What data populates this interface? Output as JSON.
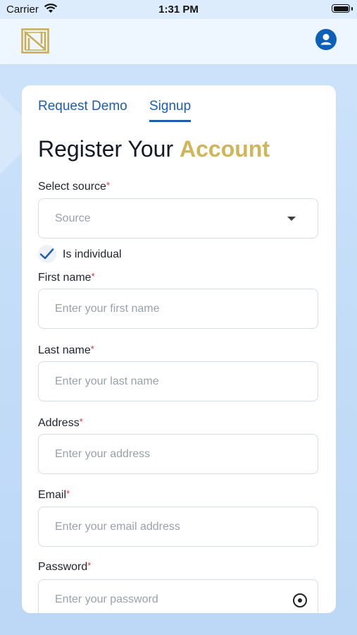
{
  "status_bar": {
    "carrier": "Carrier",
    "time": "1:31 PM"
  },
  "tabs": {
    "request_demo": "Request Demo",
    "signup": "Signup"
  },
  "heading": {
    "prefix": "Register Your ",
    "accent": "Account"
  },
  "colors": {
    "accent_gold": "#d0b658",
    "primary_blue": "#1e5db4",
    "required_red": "#d6373b"
  },
  "form": {
    "source": {
      "label": "Select source",
      "required_mark": "*",
      "placeholder": "Source"
    },
    "individual": {
      "label": "Is individual",
      "checked": true
    },
    "first_name": {
      "label": "First name",
      "required_mark": "*",
      "placeholder": "Enter your first name"
    },
    "last_name": {
      "label": "Last name",
      "required_mark": "*",
      "placeholder": "Enter your last name"
    },
    "address": {
      "label": "Address",
      "required_mark": "*",
      "placeholder": "Enter your address"
    },
    "email": {
      "label": "Email",
      "required_mark": "*",
      "placeholder": "Enter your email address"
    },
    "password": {
      "label": "Password",
      "required_mark": "*",
      "placeholder": "Enter your password"
    }
  },
  "icons": {
    "logo": "brand-logo",
    "profile": "user-profile-icon",
    "wifi": "wifi-icon",
    "battery": "battery-icon",
    "eye": "eye-icon",
    "check": "checkmark-icon",
    "dropdown": "chevron-down-icon"
  }
}
